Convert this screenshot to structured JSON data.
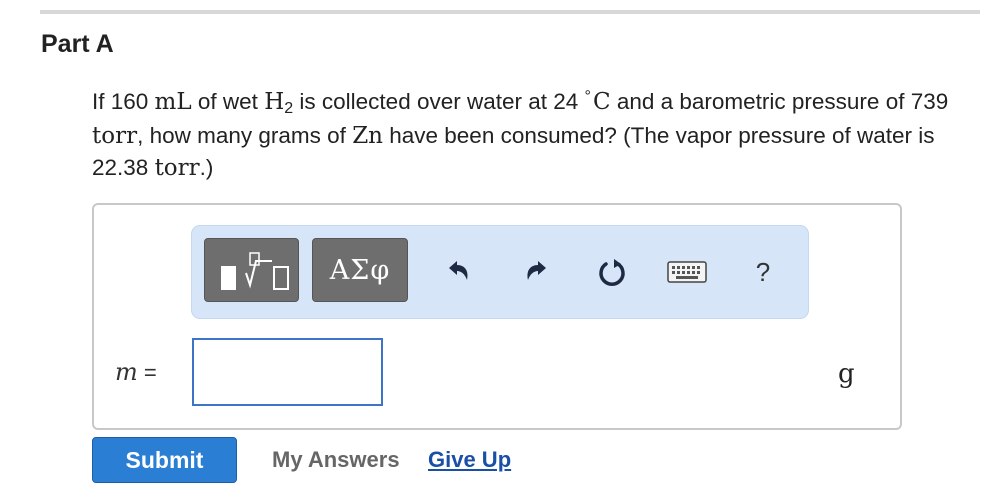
{
  "part": {
    "title": "Part A"
  },
  "question": {
    "t1": "If 160 ",
    "vol_unit": "mL",
    "t2": " of wet ",
    "gas": "H",
    "gas_sub": "2",
    "t3": " is collected over water at 24 ",
    "deg": "°",
    "temp_unit": "C",
    "t4": " and a barometric pressure of 739 ",
    "pres_unit": "torr",
    "t5": ", how many grams of ",
    "metal": "Zn",
    "t6": " have been consumed? (The vapor pressure of water is 22.38 ",
    "pres_unit2": "torr",
    "t7": ".)"
  },
  "toolbar": {
    "symbols_label": "ΑΣφ",
    "help_label": "?",
    "icons": [
      "templates-icon",
      "undo-icon",
      "redo-icon",
      "reset-icon",
      "keyboard-icon",
      "help-icon"
    ]
  },
  "answer": {
    "variable": "m",
    "equals": " =",
    "value": "",
    "placeholder": "",
    "unit": "g"
  },
  "actions": {
    "submit_label": "Submit",
    "my_answers_label": "My Answers",
    "give_up_label": "Give Up"
  },
  "colors": {
    "submit_bg": "#2a7fd4",
    "link": "#1a4fa8",
    "toolbar_bg": "#d6e6f8",
    "input_border": "#3d74c6"
  }
}
